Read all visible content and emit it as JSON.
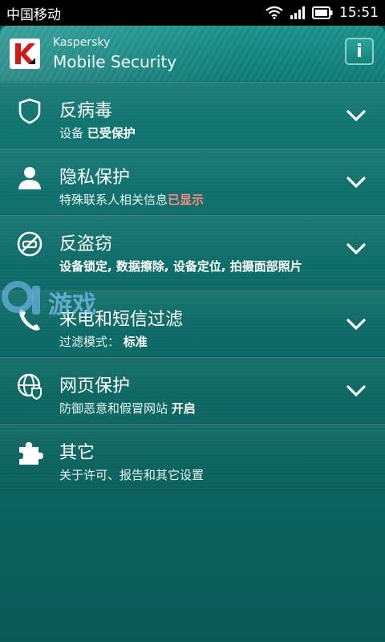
{
  "statusbar": {
    "carrier": "中国移动",
    "time": "15:51"
  },
  "header": {
    "brand": "Kaspersky",
    "product": "Mobile Security",
    "info_label": "i"
  },
  "items": [
    {
      "title": "反病毒",
      "sub_prefix": "设备 ",
      "sub_highlight": "已受保护",
      "icon": "shield-icon"
    },
    {
      "title": "隐私保护",
      "sub_prefix": "特殊联系人相关信息",
      "sub_highlight": "已显示",
      "icon": "person-icon"
    },
    {
      "title": "反盗窃",
      "sub_prefix": "",
      "sub_highlight": "设备锁定, 数据擦除, 设备定位, 拍摄面部照片",
      "icon": "anti-theft-icon"
    },
    {
      "title": "来电和短信过滤",
      "sub_prefix": "过滤模式： ",
      "sub_highlight": "标准",
      "icon": "phone-filter-icon"
    },
    {
      "title": "网页保护",
      "sub_prefix": "防御恶意和假冒网站 ",
      "sub_highlight": "开启",
      "icon": "web-globe-icon"
    },
    {
      "title": "其它",
      "sub_prefix": "关于许可、报告和其它设置",
      "sub_highlight": "",
      "icon": "puzzle-icon"
    }
  ],
  "watermark": {
    "text": "游戏"
  },
  "colors": {
    "accent_warning": "#ff8a80",
    "background": "#0d6b66"
  }
}
